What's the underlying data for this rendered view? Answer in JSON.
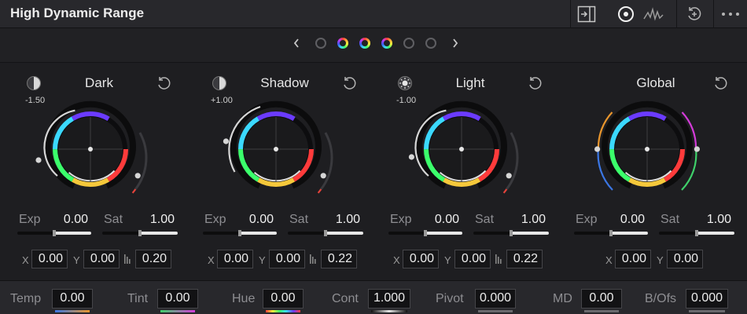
{
  "panel": {
    "title": "High Dynamic Range"
  },
  "toolbar": [
    {
      "name": "zone-panel-icon",
      "icon": "panel-expand"
    },
    {
      "name": "color-wheel-mode-icon",
      "icon": "target-circle"
    },
    {
      "name": "waveform-mode-icon",
      "icon": "waveform"
    },
    {
      "name": "reset-all-icon",
      "icon": "reset-plus"
    },
    {
      "name": "more-options-icon",
      "icon": "three-dots"
    }
  ],
  "pager": {
    "prev": "‹",
    "next": "›",
    "active_pages": [
      2,
      3,
      4
    ],
    "total": 6
  },
  "wheels": [
    {
      "title": "Dark",
      "range_value": "-1.50",
      "exp_label": "Exp",
      "exp": "0.00",
      "sat_label": "Sat",
      "sat": "1.00",
      "x_label": "X",
      "x": "0.00",
      "y_label": "Y",
      "y": "0.00",
      "falloff": "0.20",
      "show_falloff": true,
      "icon": "half-moon"
    },
    {
      "title": "Shadow",
      "range_value": "+1.00",
      "exp_label": "Exp",
      "exp": "0.00",
      "sat_label": "Sat",
      "sat": "1.00",
      "x_label": "X",
      "x": "0.00",
      "y_label": "Y",
      "y": "0.00",
      "falloff": "0.22",
      "show_falloff": true,
      "icon": "half-moon"
    },
    {
      "title": "Light",
      "range_value": "-1.00",
      "exp_label": "Exp",
      "exp": "0.00",
      "sat_label": "Sat",
      "sat": "1.00",
      "x_label": "X",
      "x": "0.00",
      "y_label": "Y",
      "y": "0.00",
      "falloff": "0.22",
      "show_falloff": true,
      "icon": "sun"
    },
    {
      "title": "Global",
      "range_value": "",
      "exp_label": "Exp",
      "exp": "0.00",
      "sat_label": "Sat",
      "sat": "1.00",
      "x_label": "X",
      "x": "0.00",
      "y_label": "Y",
      "y": "0.00",
      "falloff": "",
      "show_falloff": false,
      "icon": ""
    }
  ],
  "bottom": [
    {
      "label": "Temp",
      "value": "0.00"
    },
    {
      "label": "Tint",
      "value": "0.00"
    },
    {
      "label": "Hue",
      "value": "0.00"
    },
    {
      "label": "Cont",
      "value": "1.000"
    },
    {
      "label": "Pivot",
      "value": "0.000"
    },
    {
      "label": "MD",
      "value": "0.00"
    },
    {
      "label": "B/Ofs",
      "value": "0.000"
    }
  ],
  "colors": {
    "accent_red": "#e3433b",
    "accent_orange": "#e9962d",
    "accent_green": "#3fd06a",
    "accent_blue": "#3b76e3",
    "accent_magenta": "#d43bd9"
  }
}
